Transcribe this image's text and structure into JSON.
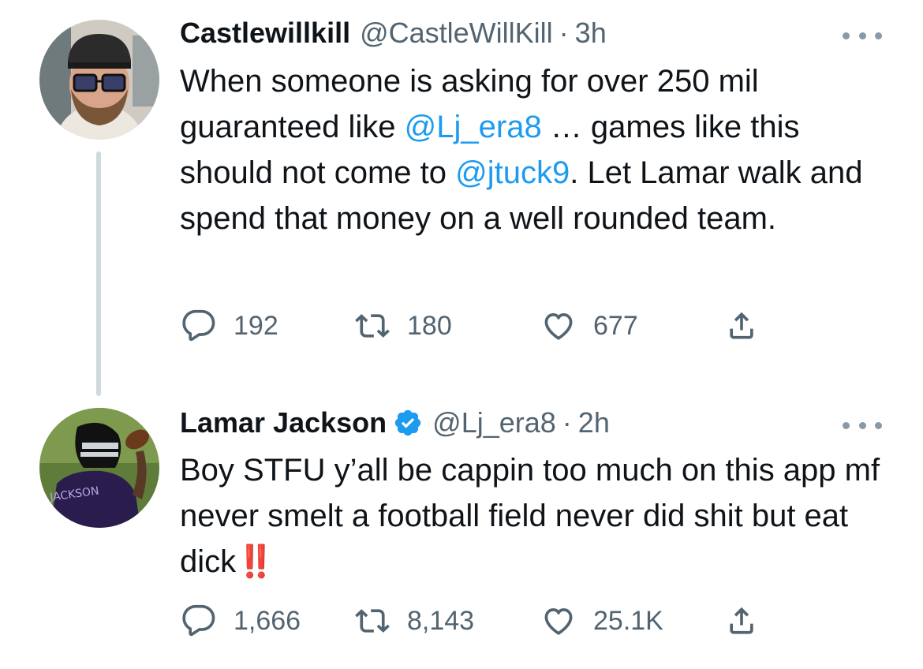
{
  "tweets": [
    {
      "avatar_icon": "user-avatar-man-glasses",
      "name": "Castlewillkill",
      "handle": "@CastleWillKill",
      "separator": "·",
      "time": "3h",
      "verified": false,
      "text_parts": {
        "p1": "When someone is asking for over 250 mil guaranteed like ",
        "m1": "@Lj_era8",
        "p2": " … games like this should not come to ",
        "m2": "@jtuck9",
        "p3": ". Let Lamar walk and spend that money on a well rounded team."
      },
      "stats": {
        "replies": "192",
        "retweets": "180",
        "likes": "677"
      }
    },
    {
      "avatar_icon": "user-avatar-football-player",
      "avatar_text": "JACKSON",
      "name": "Lamar Jackson",
      "handle": "@Lj_era8",
      "separator": "·",
      "time": "2h",
      "verified": true,
      "text_parts": {
        "p1": "Boy STFU y’all be cappin too much on this app mf never smelt a football field never did shit but eat dick",
        "emoji": "‼️"
      },
      "stats": {
        "replies": "1,666",
        "retweets": "8,143",
        "likes": "25.1K"
      }
    }
  ],
  "colors": {
    "text": "#0f1419",
    "secondary": "#536471",
    "link": "#1d9bf0",
    "thread_line": "#cfd9de",
    "emoji_red": "#e0242f"
  },
  "icons": {
    "reply": "reply-icon",
    "retweet": "retweet-icon",
    "like": "heart-icon",
    "share": "share-icon",
    "more": "more-dots-icon",
    "verified": "verified-badge-icon"
  }
}
